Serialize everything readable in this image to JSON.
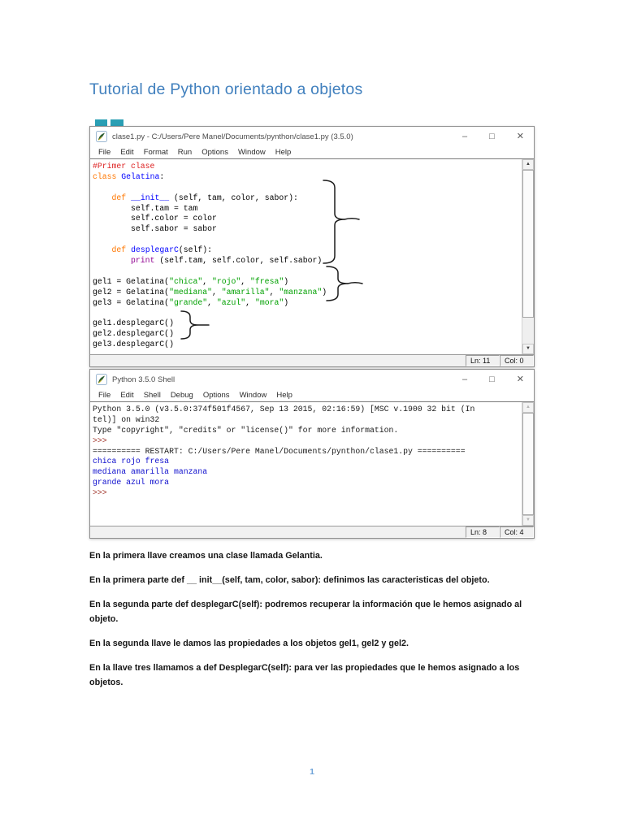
{
  "document": {
    "title": "Tutorial de Python orientado a objetos",
    "page_number": "1",
    "paragraphs": [
      "En la primera llave creamos una clase llamada Gelantia.",
      "En la primera parte def __ init__(self, tam, color, sabor): definimos las caracteristicas del objeto.",
      "En la segunda parte def desplegarC(self): podremos recuperar la información que le hemos asignado al objeto.",
      "En la segunda llave le damos las propiedades a los objetos gel1, gel2 y gel2.",
      "En la llave tres llamamos a def DesplegarC(self): para ver las propiedades que le hemos asignado a los objetos."
    ]
  },
  "colors": {
    "heading_blue": "#4180be",
    "comment_red": "#dd2222",
    "keyword_orange": "#ff7700",
    "definition_blue": "#0000ff",
    "builtin_purple": "#900090",
    "string_green": "#00a000",
    "prompt_maroon": "#a0342a",
    "stdout_blue": "#0f0fcd"
  },
  "icons": {
    "scroll_up": "▲",
    "scroll_down": "▼"
  },
  "editor_window": {
    "title": "clase1.py - C:/Users/Pere Manel/Documents/pynthon/clase1.py (3.5.0)",
    "menu": [
      "File",
      "Edit",
      "Format",
      "Run",
      "Options",
      "Window",
      "Help"
    ],
    "controls": {
      "minimize": "–",
      "maximize": "□",
      "close": "✕"
    },
    "status_line": "Ln: 11",
    "status_col": "Col: 0",
    "code_lines": [
      [
        {
          "t": "#Primer clase",
          "c": "com"
        }
      ],
      [
        {
          "t": "class",
          "c": "kw"
        },
        {
          "t": " ",
          "c": "pl"
        },
        {
          "t": "Gelatina",
          "c": "def"
        },
        {
          "t": ":",
          "c": "pl"
        }
      ],
      [],
      [
        {
          "t": "    ",
          "c": "pl"
        },
        {
          "t": "def",
          "c": "kw"
        },
        {
          "t": " ",
          "c": "pl"
        },
        {
          "t": "__init__",
          "c": "def"
        },
        {
          "t": " (self, tam, color, sabor):",
          "c": "pl"
        }
      ],
      [
        {
          "t": "        self.tam = tam",
          "c": "pl"
        }
      ],
      [
        {
          "t": "        self.color = color",
          "c": "pl"
        }
      ],
      [
        {
          "t": "        self.sabor = sabor",
          "c": "pl"
        }
      ],
      [],
      [
        {
          "t": "    ",
          "c": "pl"
        },
        {
          "t": "def",
          "c": "kw"
        },
        {
          "t": " ",
          "c": "pl"
        },
        {
          "t": "desplegarC",
          "c": "def"
        },
        {
          "t": "(self):",
          "c": "pl"
        }
      ],
      [
        {
          "t": "        ",
          "c": "pl"
        },
        {
          "t": "print",
          "c": "blt"
        },
        {
          "t": " (self.tam, self.color, self.sabor)",
          "c": "pl"
        }
      ],
      [],
      [
        {
          "t": "gel1 = Gelatina(",
          "c": "pl"
        },
        {
          "t": "\"chica\"",
          "c": "str"
        },
        {
          "t": ", ",
          "c": "pl"
        },
        {
          "t": "\"rojo\"",
          "c": "str"
        },
        {
          "t": ", ",
          "c": "pl"
        },
        {
          "t": "\"fresa\"",
          "c": "str"
        },
        {
          "t": ")",
          "c": "pl"
        }
      ],
      [
        {
          "t": "gel2 = Gelatina(",
          "c": "pl"
        },
        {
          "t": "\"mediana\"",
          "c": "str"
        },
        {
          "t": ", ",
          "c": "pl"
        },
        {
          "t": "\"amarilla\"",
          "c": "str"
        },
        {
          "t": ", ",
          "c": "pl"
        },
        {
          "t": "\"manzana\"",
          "c": "str"
        },
        {
          "t": ")",
          "c": "pl"
        }
      ],
      [
        {
          "t": "gel3 = Gelatina(",
          "c": "pl"
        },
        {
          "t": "\"grande\"",
          "c": "str"
        },
        {
          "t": ", ",
          "c": "pl"
        },
        {
          "t": "\"azul\"",
          "c": "str"
        },
        {
          "t": ", ",
          "c": "pl"
        },
        {
          "t": "\"mora\"",
          "c": "str"
        },
        {
          "t": ")",
          "c": "pl"
        }
      ],
      [],
      [
        {
          "t": "gel1.desplegarC()",
          "c": "pl"
        }
      ],
      [
        {
          "t": "gel2.desplegarC()",
          "c": "pl"
        }
      ],
      [
        {
          "t": "gel3.desplegarC()",
          "c": "pl"
        }
      ]
    ]
  },
  "shell_window": {
    "title": "Python 3.5.0 Shell",
    "menu": [
      "File",
      "Edit",
      "Shell",
      "Debug",
      "Options",
      "Window",
      "Help"
    ],
    "controls": {
      "minimize": "–",
      "maximize": "□",
      "close": "✕"
    },
    "status_line": "Ln: 8",
    "status_col": "Col: 4",
    "lines": [
      [
        {
          "t": "Python 3.5.0 (v3.5.0:374f501f4567, Sep 13 2015, 02:16:59) [MSC v.1900 32 bit (In",
          "c": "out"
        }
      ],
      [
        {
          "t": "tel)] on win32",
          "c": "out"
        }
      ],
      [
        {
          "t": "Type \"copyright\", \"credits\" or \"license()\" for more information.",
          "c": "out"
        }
      ],
      [
        {
          "t": ">>> ",
          "c": "prm"
        }
      ],
      [
        {
          "t": "========== RESTART: C:/Users/Pere Manel/Documents/pynthon/clase1.py ==========",
          "c": "out"
        }
      ],
      [
        {
          "t": "chica rojo fresa",
          "c": "std"
        }
      ],
      [
        {
          "t": "mediana amarilla manzana",
          "c": "std"
        }
      ],
      [
        {
          "t": "grande azul mora",
          "c": "std"
        }
      ],
      [
        {
          "t": ">>> ",
          "c": "prm"
        }
      ]
    ]
  }
}
